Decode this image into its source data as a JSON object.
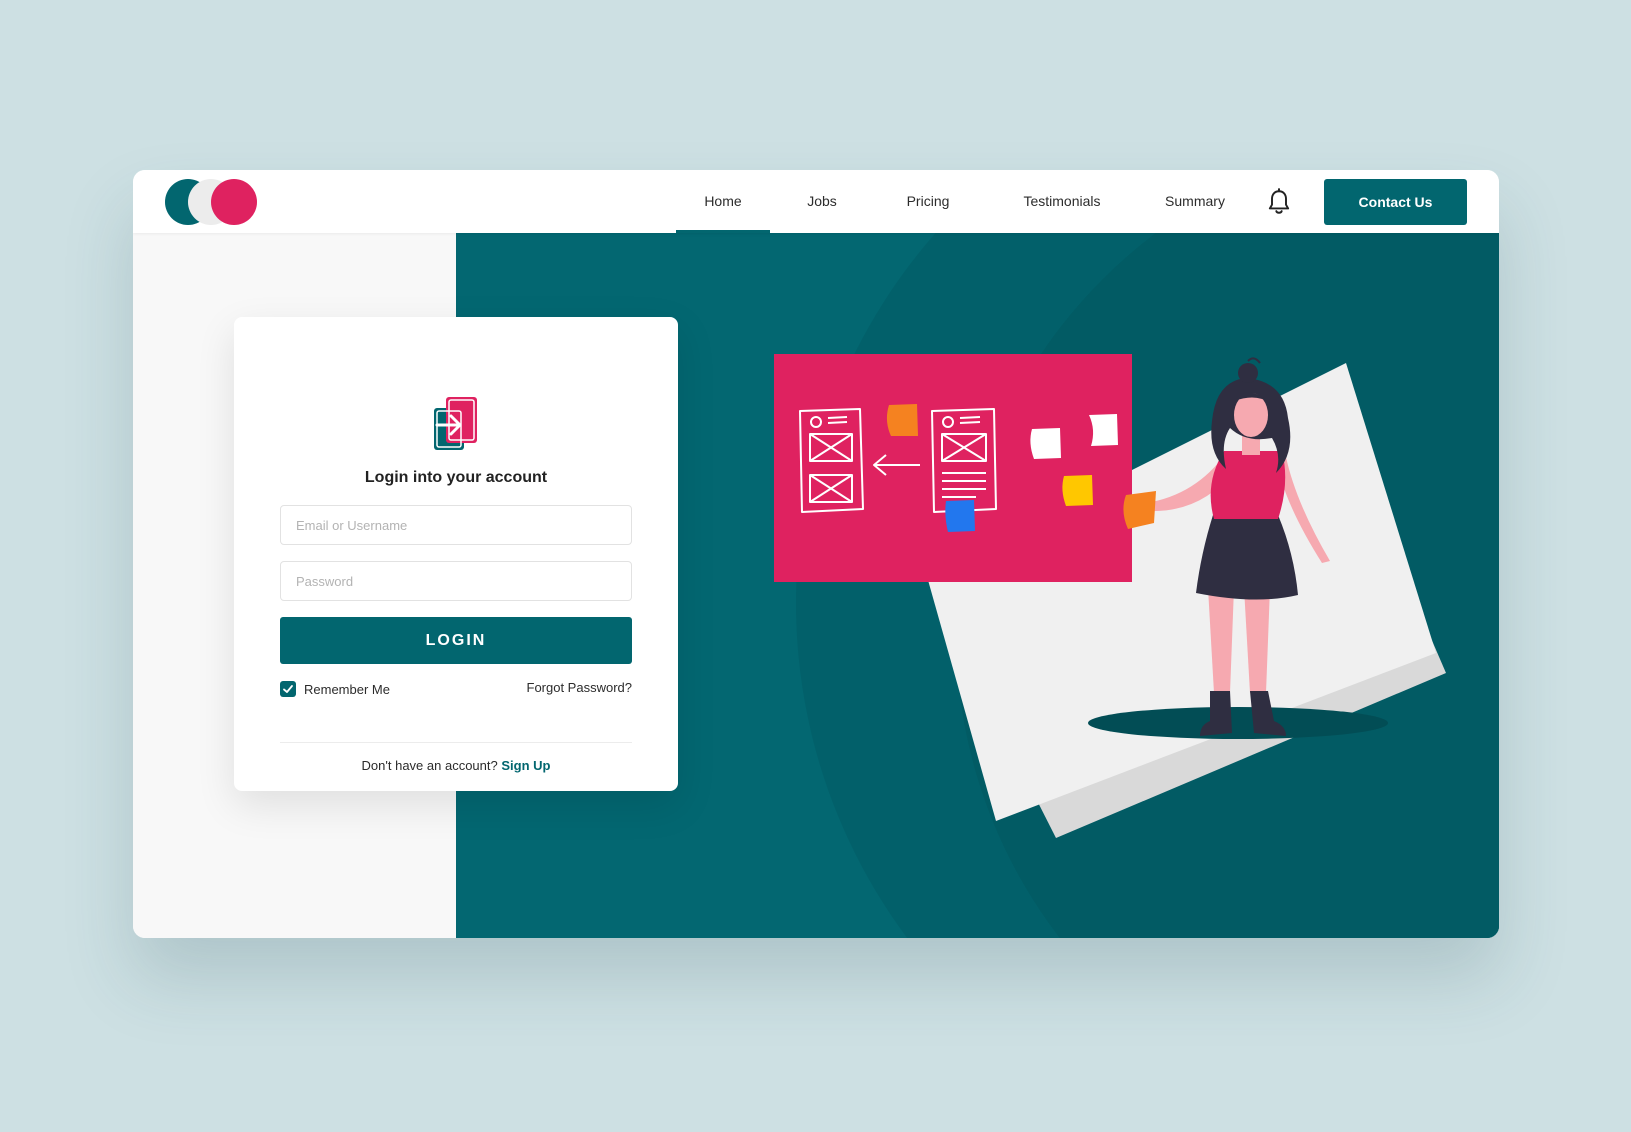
{
  "nav": {
    "items": [
      {
        "label": "Home",
        "active": true
      },
      {
        "label": "Jobs",
        "active": false
      },
      {
        "label": "Pricing",
        "active": false
      },
      {
        "label": "Testimonials",
        "active": false
      },
      {
        "label": "Summary",
        "active": false
      }
    ],
    "contact_label": "Contact Us"
  },
  "login": {
    "title": "Login into your account",
    "email_placeholder": "Email or Username",
    "password_placeholder": "Password",
    "button_label": "LOGIN",
    "remember_label": "Remember Me",
    "remember_checked": true,
    "forgot_label": "Forgot Password?",
    "signup_prompt": "Don't have an account?",
    "signup_label": "Sign Up"
  },
  "icons": {
    "logo": "three-circles-logo",
    "bell": "bell-icon",
    "login": "login-icon",
    "check": "check-icon"
  },
  "colors": {
    "brand_teal": "#02666f",
    "brand_pink": "#df2260",
    "page_background": "#cde0e3"
  }
}
